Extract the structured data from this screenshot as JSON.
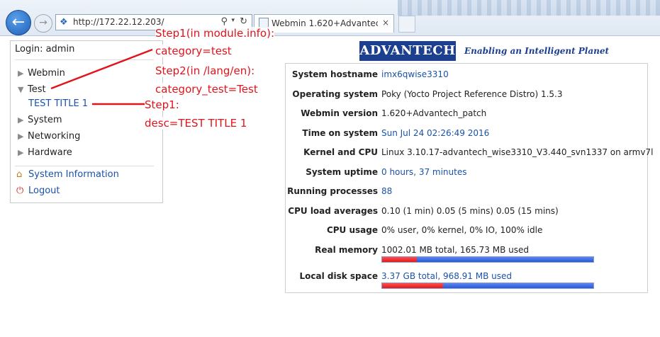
{
  "browser": {
    "url": "http://172.22.12.203/",
    "tab_title": "Webmin 1.620+Advantech_patch",
    "tab_close": "×",
    "icons": {
      "back": "arrow-left-icon",
      "forward": "arrow-right-icon",
      "search": "search-icon",
      "refresh": "refresh-icon"
    }
  },
  "sidebar": {
    "login": "Login: admin",
    "items": [
      {
        "label": "Webmin",
        "expanded": false
      },
      {
        "label": "Test",
        "expanded": true,
        "children": [
          "TEST TITLE 1"
        ]
      },
      {
        "label": "System",
        "expanded": false
      },
      {
        "label": "Networking",
        "expanded": false
      },
      {
        "label": "Hardware",
        "expanded": false
      }
    ],
    "system_info": "System Information",
    "logout": "Logout"
  },
  "brand": {
    "logo": "ADVANTECH",
    "tagline": "Enabling an Intelligent Planet",
    "logo_color": "#1d3f8f"
  },
  "system_info": [
    {
      "label": "System hostname",
      "value": "imx6qwise3310",
      "link": true
    },
    {
      "label": "Operating system",
      "value": "Poky (Yocto Project Reference Distro) 1.5.3",
      "link": false
    },
    {
      "label": "Webmin version",
      "value": "1.620+Advantech_patch",
      "link": false
    },
    {
      "label": "Time on system",
      "value": "Sun Jul 24 02:26:49 2016",
      "link": true
    },
    {
      "label": "Kernel and CPU",
      "value": "Linux 3.10.17-advantech_wise3310_V3.440_svn1337 on armv7l",
      "link": false
    },
    {
      "label": "System uptime",
      "value": "0 hours, 37 minutes",
      "link": true
    },
    {
      "label": "Running processes",
      "value": "88",
      "link": true
    },
    {
      "label": "CPU load averages",
      "value": "0.10 (1 min) 0.05 (5 mins) 0.05 (15 mins)",
      "link": false
    },
    {
      "label": "CPU usage",
      "value": "0% user, 0% kernel, 0% IO, 100% idle",
      "link": false
    },
    {
      "label": "Real memory",
      "value": "1002.01 MB total, 165.73 MB used",
      "link": false,
      "usage_fraction": 0.165
    },
    {
      "label": "Local disk space",
      "value": "3.37 GB total, 968.91 MB used",
      "link": true,
      "usage_fraction": 0.287
    }
  ],
  "annotations": {
    "note1_line1": "Step1(in module.info):",
    "note1_line2": "category=test",
    "note2_line1": "Step2(in /lang/en):",
    "note2_line2": "category_test=Test",
    "note3_line1": "Step1:",
    "note3_line2": "desc=TEST TITLE 1",
    "color": "#e0141b"
  },
  "colors": {
    "link": "#1a52a8",
    "bar_used": "#e01a1a",
    "bar_free": "#2a57d8"
  }
}
